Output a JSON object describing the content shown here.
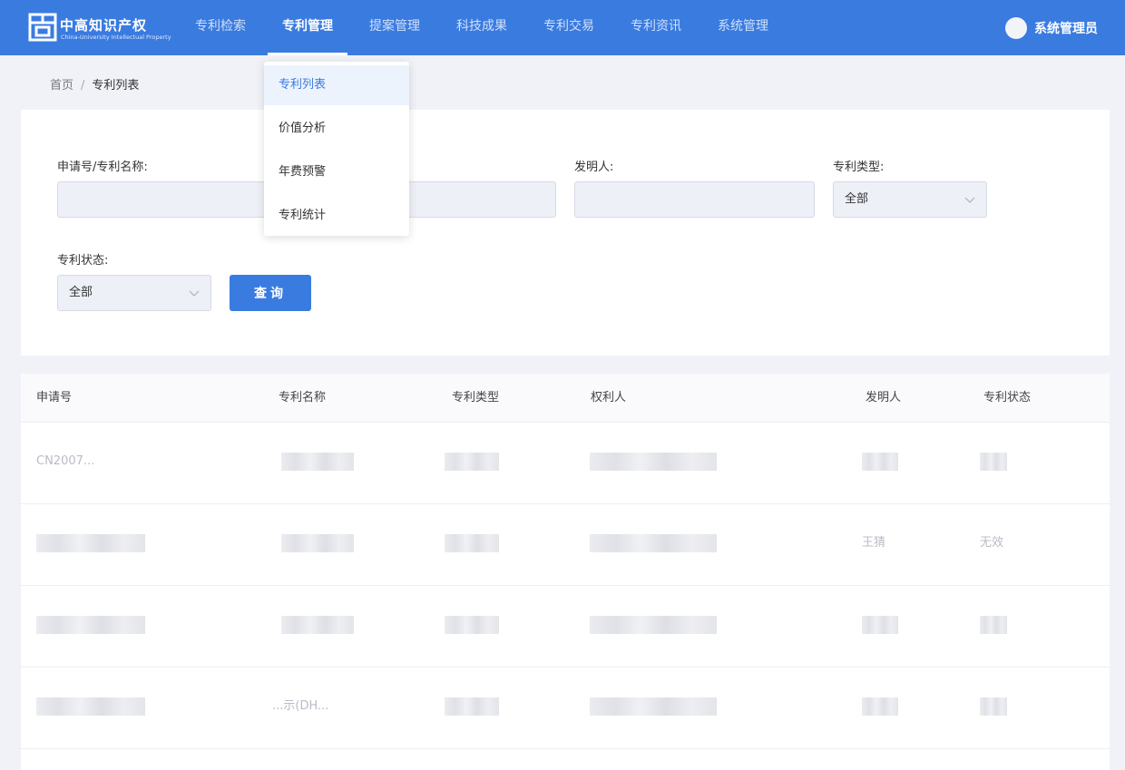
{
  "brand": {
    "name_cn": "中高知识产权",
    "name_en": "China-University Intellectual Property"
  },
  "nav": {
    "items": [
      {
        "label": "专利检索"
      },
      {
        "label": "专利管理"
      },
      {
        "label": "提案管理"
      },
      {
        "label": "科技成果"
      },
      {
        "label": "专利交易"
      },
      {
        "label": "专利资讯"
      },
      {
        "label": "系统管理"
      }
    ],
    "active": "专利管理",
    "user": "系统管理员"
  },
  "dropdown": {
    "items": [
      {
        "label": "专利列表"
      },
      {
        "label": "价值分析"
      },
      {
        "label": "年费预警"
      },
      {
        "label": "专利统计"
      }
    ],
    "selected": "专利列表"
  },
  "breadcrumb": {
    "home": "首页",
    "separator": "/",
    "current": "专利列表"
  },
  "filters": {
    "appno_label": "申请号/专利名称:",
    "inventor_label": "发明人:",
    "type_label": "专利类型:",
    "type_value": "全部",
    "status_label": "专利状态:",
    "status_value": "全部",
    "query_button": "查询"
  },
  "table": {
    "columns": [
      "申请号",
      "专利名称",
      "专利类型",
      "权利人",
      "发明人",
      "专利状态"
    ],
    "rows": [
      {
        "appno": "CN2007...",
        "name": "",
        "type": "",
        "owner": "",
        "inventor": "",
        "status": ""
      },
      {
        "appno": "",
        "name": "",
        "type": "",
        "owner": "",
        "inventor": "王猜",
        "status": "无效"
      },
      {
        "appno": "",
        "name": "",
        "type": "",
        "owner": "",
        "inventor": "",
        "status": ""
      },
      {
        "appno": "",
        "name": "...示(DH...",
        "type": "",
        "owner": "",
        "inventor": "",
        "status": ""
      }
    ]
  },
  "colors": {
    "accent": "#3a7be0",
    "page_bg": "#f0f2f8",
    "input_bg": "#eef0f7"
  }
}
